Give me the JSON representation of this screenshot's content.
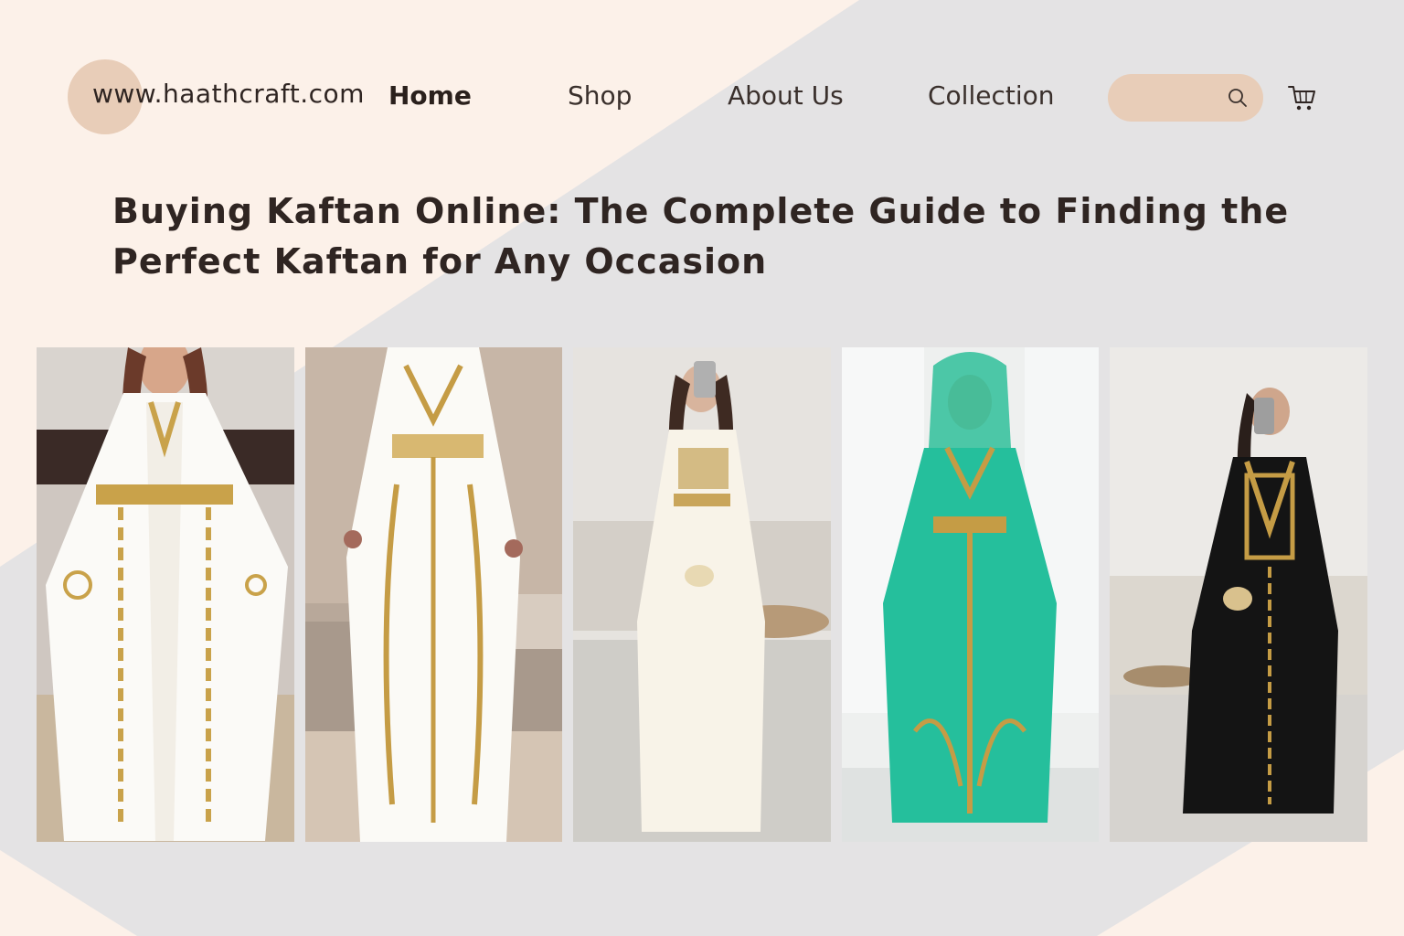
{
  "site": {
    "logo_text": "www.haathcraft.com"
  },
  "nav": {
    "home": "Home",
    "shop": "Shop",
    "about": "About Us",
    "collection": "Collection"
  },
  "search": {
    "placeholder": "",
    "icon": "search-icon"
  },
  "cart": {
    "icon": "cart-icon"
  },
  "article": {
    "title": "Buying Kaftan Online: The Complete  Guide to Finding the Perfect Kaftan for Any Occasion"
  },
  "gallery": [
    {
      "dress_color": "white with gold embroidery",
      "setting": "marble hallway"
    },
    {
      "dress_color": "white with gold embroidery",
      "setting": "living room"
    },
    {
      "dress_color": "cream with gold embroidery",
      "setting": "living room"
    },
    {
      "dress_color": "turquoise with gold embroidery",
      "setting": "bright studio"
    },
    {
      "dress_color": "black with gold embroidery",
      "setting": "living room"
    }
  ],
  "colors": {
    "background_cream": "#fcf1e9",
    "background_grey": "#e4e3e4",
    "accent_peach": "#e8cdb8",
    "text_dark": "#2f2522"
  }
}
